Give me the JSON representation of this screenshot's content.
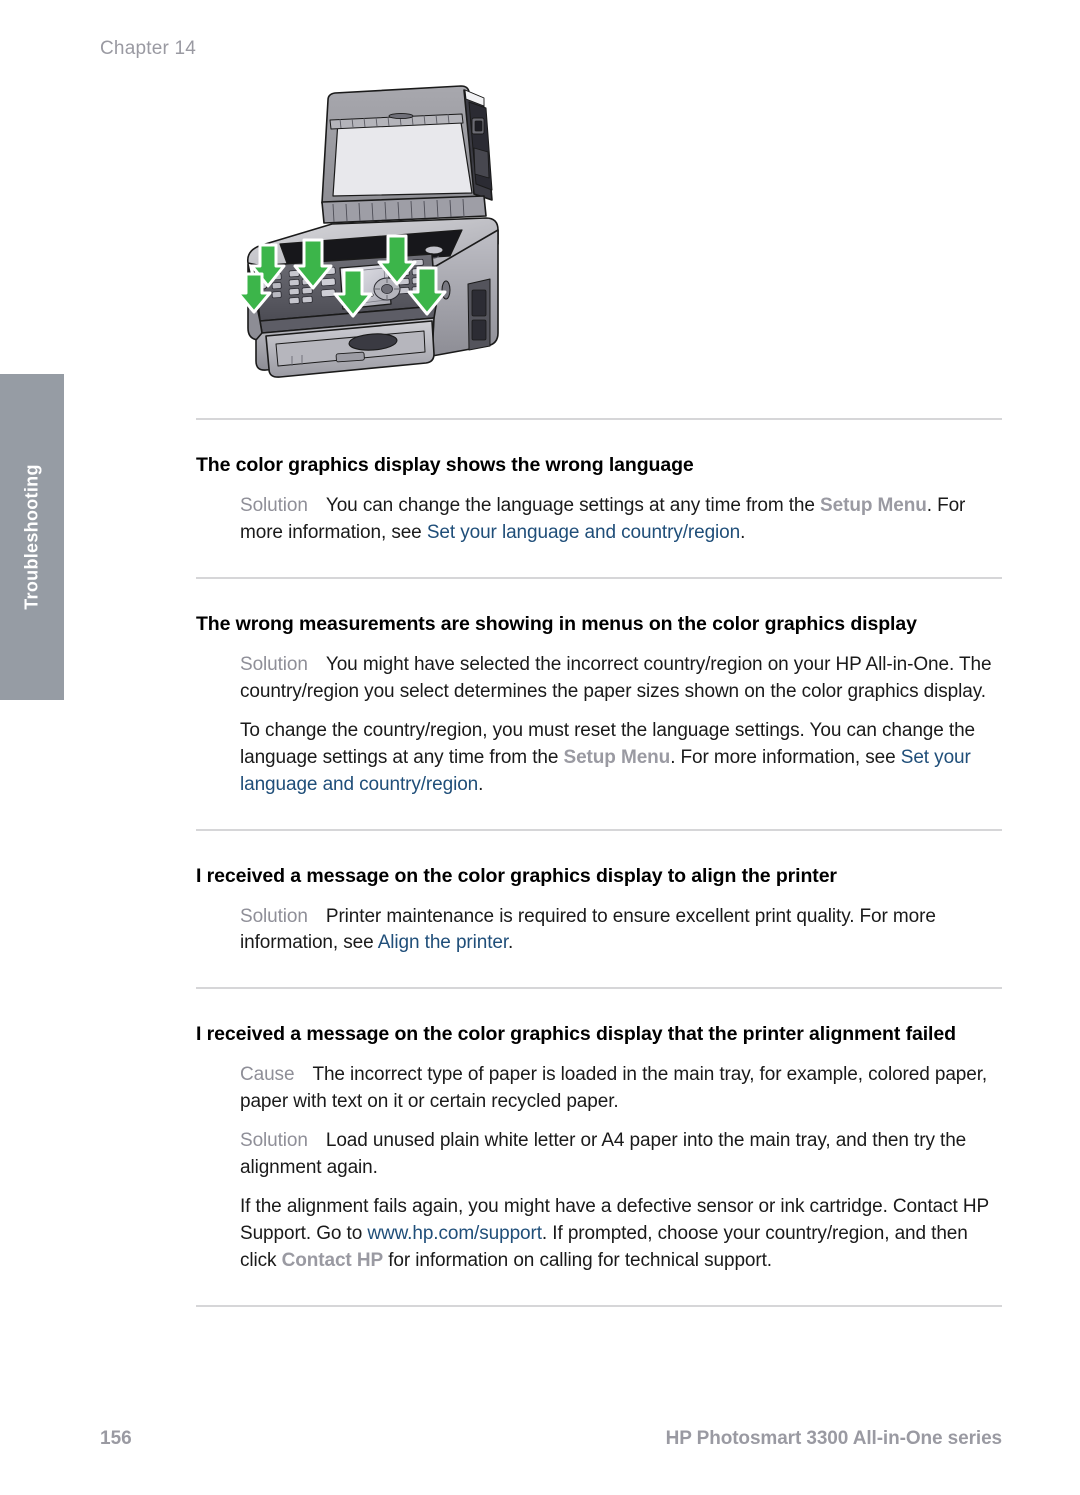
{
  "header": {
    "chapter": "Chapter 14"
  },
  "side_tab": {
    "label": "Troubleshooting",
    "background_color": "#969ca4",
    "text_color": "#ffffff"
  },
  "illustration": {
    "name": "hp-all-in-one-open-lid-with-green-arrows",
    "description": "HP All-in-One printer with scanner lid open and green downward arrows pointing at the control panel",
    "arrow_color": "#3cb54a",
    "arrow_count": 6
  },
  "colors": {
    "link": "#1f4e79",
    "ui_term": "#9a9aa2",
    "lead_label": "#8f8f98",
    "rule": "#d6d6d8",
    "footer_text": "#9a9aa2"
  },
  "sections": [
    {
      "title": "The color graphics display shows the wrong language",
      "paragraphs": [
        {
          "lead": "Solution",
          "runs": [
            {
              "type": "text",
              "text": "You can change the language settings at any time from the "
            },
            {
              "type": "ui",
              "text": "Setup Menu"
            },
            {
              "type": "text",
              "text": ". For more information, see "
            },
            {
              "type": "link",
              "text": "Set your language and country/region"
            },
            {
              "type": "text",
              "text": "."
            }
          ]
        }
      ]
    },
    {
      "title": "The wrong measurements are showing in menus on the color graphics display",
      "paragraphs": [
        {
          "lead": "Solution",
          "runs": [
            {
              "type": "text",
              "text": "You might have selected the incorrect country/region on your HP All-in-One. The country/region you select determines the paper sizes shown on the color graphics display."
            }
          ]
        },
        {
          "lead": "",
          "runs": [
            {
              "type": "text",
              "text": "To change the country/region, you must reset the language settings. You can change the language settings at any time from the "
            },
            {
              "type": "ui",
              "text": "Setup Menu"
            },
            {
              "type": "text",
              "text": ". For more information, see "
            },
            {
              "type": "link",
              "text": "Set your language and country/region"
            },
            {
              "type": "text",
              "text": "."
            }
          ]
        }
      ]
    },
    {
      "title": "I received a message on the color graphics display to align the printer",
      "paragraphs": [
        {
          "lead": "Solution",
          "runs": [
            {
              "type": "text",
              "text": "Printer maintenance is required to ensure excellent print quality. For more information, see "
            },
            {
              "type": "link",
              "text": "Align the printer"
            },
            {
              "type": "text",
              "text": "."
            }
          ]
        }
      ]
    },
    {
      "title": "I received a message on the color graphics display that the printer alignment failed",
      "paragraphs": [
        {
          "lead": "Cause",
          "runs": [
            {
              "type": "text",
              "text": "The incorrect type of paper is loaded in the main tray, for example, colored paper, paper with text on it or certain recycled paper."
            }
          ]
        },
        {
          "lead": "Solution",
          "runs": [
            {
              "type": "text",
              "text": "Load unused plain white letter or A4 paper into the main tray, and then try the alignment again."
            }
          ]
        },
        {
          "lead": "",
          "runs": [
            {
              "type": "text",
              "text": "If the alignment fails again, you might have a defective sensor or ink cartridge. Contact HP Support. Go to "
            },
            {
              "type": "link",
              "text": "www.hp.com/support"
            },
            {
              "type": "text",
              "text": ". If prompted, choose your country/region, and then click "
            },
            {
              "type": "ui",
              "text": "Contact HP"
            },
            {
              "type": "text",
              "text": " for information on calling for technical support."
            }
          ]
        }
      ]
    }
  ],
  "footer": {
    "page_number": "156",
    "product_name": "HP Photosmart 3300 All-in-One series"
  }
}
